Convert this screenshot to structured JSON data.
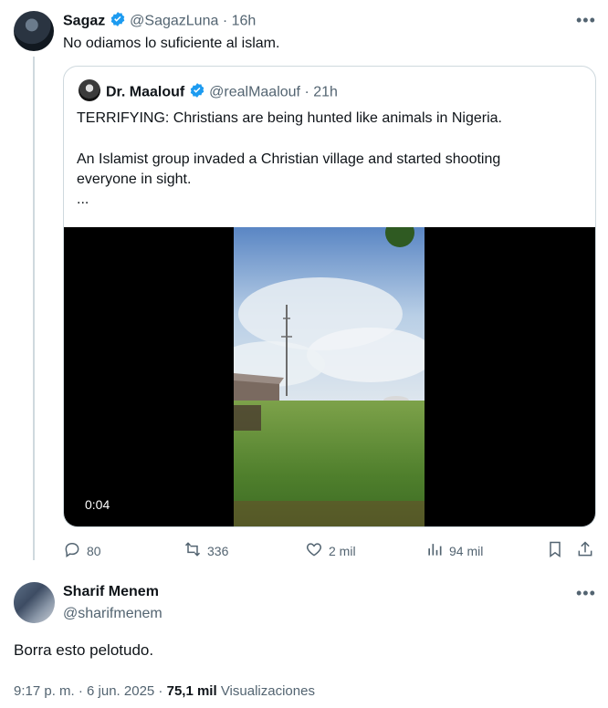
{
  "tweet": {
    "author_name": "Sagaz",
    "author_handle": "@SagazLuna",
    "time": "· 16h",
    "text": "No odiamos lo suficiente al islam.",
    "quote": {
      "author_name": "Dr. Maalouf",
      "author_handle": "@realMaalouf",
      "time": "· 21h",
      "line1": "TERRIFYING: Christians are being hunted like animals in Nigeria.",
      "line2a": "An Islamist group invaded a Christian village and started shooting",
      "line2b": "everyone in sight.",
      "ellipsis": "...",
      "video_time": "0:04"
    },
    "actions": {
      "replies": "80",
      "reposts": "336",
      "likes": "2 mil",
      "views": "94 mil"
    }
  },
  "reply": {
    "author_name": "Sharif Menem",
    "author_handle": "@sharifmenem",
    "text": "Borra esto pelotudo.",
    "timestamp": "9:17 p. m. · 6 jun. 2025 ·",
    "views_count": "75,1 mil",
    "views_label": "Visualizaciones"
  },
  "colors": {
    "verified_blue": "#1d9bf0",
    "secondary_text": "#536471",
    "border": "#cfd9de"
  },
  "icons": [
    "more-icon",
    "verified-badge-icon",
    "reply-icon",
    "repost-icon",
    "like-icon",
    "views-icon",
    "bookmark-icon",
    "share-icon"
  ]
}
